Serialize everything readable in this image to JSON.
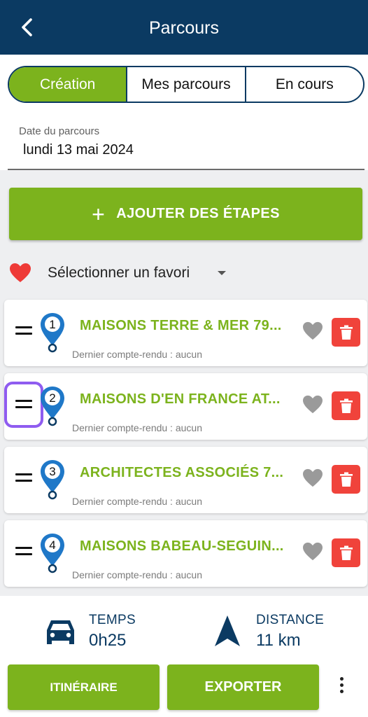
{
  "header": {
    "title": "Parcours",
    "back_icon": "chevron-left-icon",
    "color": "#0b3a62"
  },
  "tabs": [
    {
      "label": "Création",
      "active": true
    },
    {
      "label": "Mes parcours",
      "active": false
    },
    {
      "label": "En cours",
      "active": false
    }
  ],
  "date": {
    "label": "Date du parcours",
    "value": "lundi 13 mai 2024"
  },
  "add_button": {
    "label": "AJOUTER DES ÉTAPES",
    "icon": "plus-icon"
  },
  "favorite": {
    "label": "Sélectionner un favori",
    "icon": "heart-icon"
  },
  "stops": [
    {
      "number": "1",
      "title": "MAISONS TERRE & MER 79...",
      "subtitle": "Dernier compte-rendu : aucun"
    },
    {
      "number": "2",
      "title": "MAISONS D'EN FRANCE AT...",
      "subtitle": "Dernier compte-rendu : aucun"
    },
    {
      "number": "3",
      "title": "ARCHITECTES ASSOCIÉS 7...",
      "subtitle": "Dernier compte-rendu : aucun"
    },
    {
      "number": "4",
      "title": "MAISONS BABEAU-SEGUIN...",
      "subtitle": "Dernier compte-rendu : aucun"
    }
  ],
  "stats": {
    "time": {
      "label": "TEMPS",
      "value": "0h25",
      "icon": "car-icon"
    },
    "distance": {
      "label": "DISTANCE",
      "value": "11 km",
      "icon": "navigation-arrow-icon"
    }
  },
  "footer": {
    "itinerary_label": "ITINÉRAIRE",
    "export_label": "EXPORTER",
    "more_icon": "more-vertical-icon"
  },
  "colors": {
    "accent": "#7cb31d",
    "navy": "#0b3a62",
    "danger": "#f0433b",
    "pin": "#1f78c8",
    "highlight": "#8f5cf0"
  }
}
